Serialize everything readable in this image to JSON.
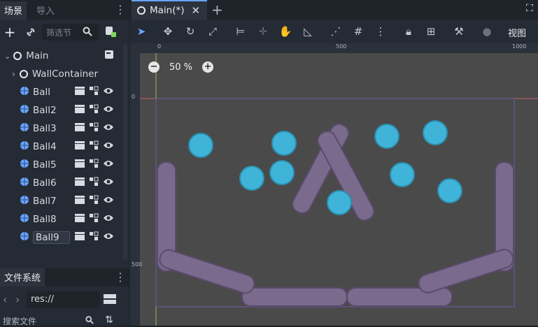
{
  "scene_dock": {
    "tabs": [
      {
        "label": "场景"
      },
      {
        "label": "导入"
      }
    ],
    "filter_placeholder": "筛选节",
    "nodes": [
      {
        "label": "Main"
      },
      {
        "label": "WallContainer"
      },
      {
        "label": "Ball"
      },
      {
        "label": "Ball2"
      },
      {
        "label": "Ball3"
      },
      {
        "label": "Ball4"
      },
      {
        "label": "Ball5"
      },
      {
        "label": "Ball6"
      },
      {
        "label": "Ball7"
      },
      {
        "label": "Ball8"
      },
      {
        "label": "Ball9"
      }
    ]
  },
  "filesystem": {
    "tab_label": "文件系统",
    "path": "res://",
    "search_placeholder": "搜索文件"
  },
  "editor": {
    "tab_label": "Main(*)",
    "view_menu": "视图",
    "zoom_label": "50 %",
    "ruler_ticks": [
      "0",
      "500",
      "1000"
    ],
    "vruler_ticks": [
      "0",
      "500"
    ]
  },
  "colors": {
    "accent": "#6aa4ff",
    "ball": "#3fb4d8",
    "wall": "#7a6a8c",
    "selection": "#c7596e"
  }
}
